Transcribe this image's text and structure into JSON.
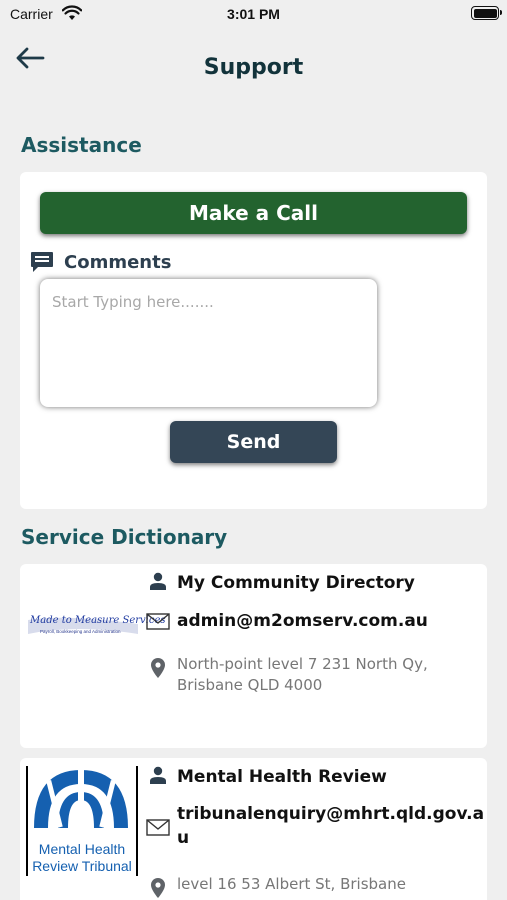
{
  "status_bar": {
    "carrier": "Carrier",
    "time": "3:01 PM"
  },
  "header": {
    "title": "Support"
  },
  "assistance": {
    "section_title": "Assistance",
    "call_label": "Make a Call",
    "comments_label": "Comments",
    "comment_placeholder": "Start Typing here.......",
    "send_label": "Send"
  },
  "directory": {
    "section_title": "Service Dictionary",
    "items": [
      {
        "name": "My Community Directory",
        "email": "admin@m2omserv.com.au",
        "address_lines": [
          "North-point level 7 231 North Qy,",
          "Brisbane QLD 4000"
        ],
        "logo_text": "Made to Measure Services",
        "logo_subtext": "Payroll, Bookkeeping and Administration"
      },
      {
        "name": "Mental Health Review",
        "email_lines": [
          "tribunalenquiry@mhrt.qld.gov.a",
          "u"
        ],
        "address_lines": [
          "level 16 53 Albert St, Brisbane"
        ],
        "logo_lines": [
          "Mental Health",
          "Review Tribunal"
        ]
      }
    ]
  },
  "colors": {
    "background": "#efefef",
    "call_button": "#23632f",
    "send_button": "#344656",
    "section_title": "#1d5a61",
    "header_title": "#12333b"
  }
}
